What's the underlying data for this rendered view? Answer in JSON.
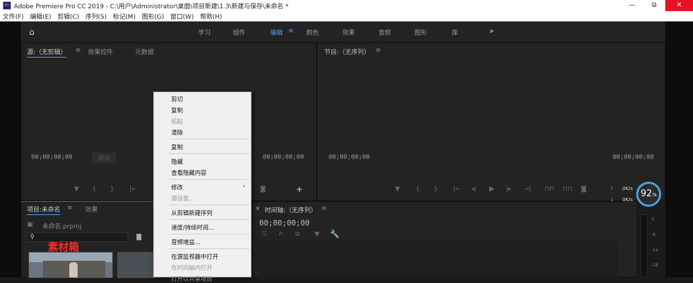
{
  "titlebar": {
    "app_icon": "Pr",
    "title": "Adobe Premiere Pro CC 2019 - C:\\用户\\Administrator\\桌面\\项目新建\\1.3\\新建与保存\\未命名 *",
    "minimize": "—",
    "restore": "⧉",
    "close": "✕"
  },
  "menubar": {
    "items": [
      "文件(F)",
      "编辑(E)",
      "剪辑(C)",
      "序列(S)",
      "标记(M)",
      "图形(G)",
      "窗口(W)",
      "帮助(H)"
    ]
  },
  "workspaces": {
    "home_icon": "home-icon",
    "tabs": [
      "学习",
      "组件",
      "编辑",
      "颜色",
      "效果",
      "音频",
      "图形",
      "库"
    ],
    "active": "编辑",
    "menu_glyph": "≡",
    "more": "»"
  },
  "source_panel": {
    "tabs": [
      "源:（无剪辑）",
      "效果控件",
      "元数据"
    ],
    "menu_glyph": "≡",
    "timecode_left": "00;00;00;00",
    "fit_label": "适合",
    "timecode_right": "00;00;00;00"
  },
  "program_panel": {
    "title": "节目:（无序列）",
    "menu_glyph": "≡",
    "timecode_left": "00;00;00;00",
    "timecode_right": "00;00;00;00"
  },
  "project_panel": {
    "tabs": [
      "项目:未命名",
      "效果"
    ],
    "menu_glyph": "≡",
    "file_name": "未命名.prproj",
    "search_placeholder": "",
    "overlay_label": "素材箱",
    "overlay_color": "#ff2a2a"
  },
  "timeline_panel": {
    "title": "时间轴:（无序列）",
    "menu_glyph": "≡",
    "timecode": "00;00;00;00",
    "close": "×"
  },
  "context_menu": {
    "items": [
      {
        "label": "剪切",
        "enabled": true
      },
      {
        "label": "复制",
        "enabled": true
      },
      {
        "label": "粘贴",
        "enabled": false
      },
      {
        "label": "清除",
        "enabled": true
      },
      {
        "label": "复制",
        "enabled": true
      },
      {
        "label": "隐藏",
        "enabled": true
      },
      {
        "label": "查看隐藏内容",
        "enabled": true
      },
      {
        "label": "修改",
        "enabled": true,
        "submenu": true
      },
      {
        "label": "源设置...",
        "enabled": false
      },
      {
        "label": "从剪辑新建序列",
        "enabled": true
      },
      {
        "label": "速度/持续时间...",
        "enabled": true
      },
      {
        "label": "音频增益...",
        "enabled": true
      },
      {
        "label": "在源监视器中打开",
        "enabled": true
      },
      {
        "label": "在时间轴内打开",
        "enabled": false
      },
      {
        "label": "打开以共享项目",
        "enabled": false
      }
    ],
    "submenu_arrow": "›"
  },
  "speed_widget": {
    "percent": "92",
    "percent_sign": "%",
    "up_rate": "0",
    "up_unit": "K/s",
    "down_rate": "0",
    "down_unit": "K/s",
    "up_color": "#4aa3e0",
    "down_color": "#4ad04a"
  },
  "audio_meter": {
    "ticks": [
      "0",
      "-6",
      "-12",
      "-18"
    ]
  },
  "colors": {
    "accent": "#4a9dff",
    "panel_bg": "#232323"
  }
}
